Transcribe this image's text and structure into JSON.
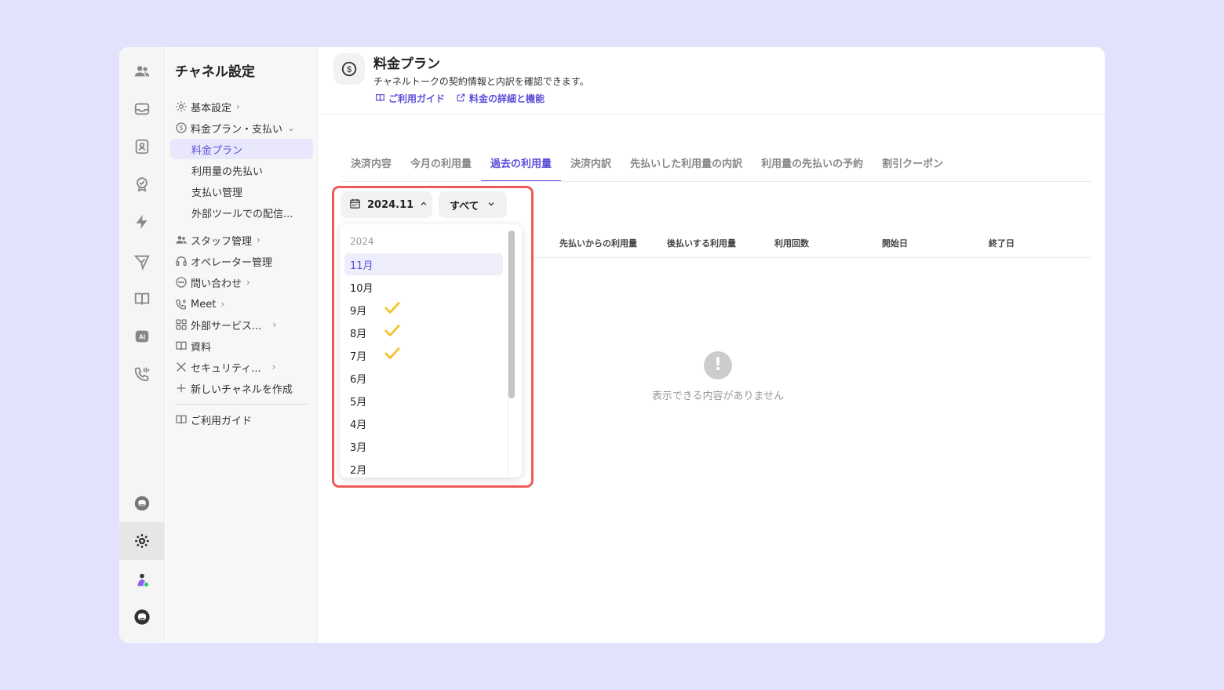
{
  "sidebar": {
    "title": "チャネル設定",
    "items": [
      {
        "label": "基本設定",
        "chev": "›"
      },
      {
        "label": "料金プラン・支払い",
        "chev": "⌄"
      },
      {
        "label": "料金プラン"
      },
      {
        "label": "利用量の先払い"
      },
      {
        "label": "支払い管理"
      },
      {
        "label": "外部ツールでの配信..."
      },
      {
        "label": "スタッフ管理",
        "chev": "›"
      },
      {
        "label": "オペレーター管理"
      },
      {
        "label": "問い合わせ",
        "chev": "›"
      },
      {
        "label": "Meet",
        "chev": "›"
      },
      {
        "label": "外部サービス...",
        "chev": "›"
      },
      {
        "label": "資料"
      },
      {
        "label": "セキュリティ...",
        "chev": "›"
      },
      {
        "label": "新しいチャネルを作成"
      },
      {
        "label": "ご利用ガイド"
      }
    ]
  },
  "header": {
    "title": "料金プラン",
    "description": "チャネルトークの契約情報と内訳を確認できます。",
    "link_guide": "ご利用ガイド",
    "link_details": "料金の詳細と機能"
  },
  "tabs": [
    "決済内容",
    "今月の利用量",
    "過去の利用量",
    "決済内訳",
    "先払いした利用量の内訳",
    "利用量の先払いの予約",
    "割引クーポン"
  ],
  "active_tab": "過去の利用量",
  "filters": {
    "date_value": "2024.11",
    "status_value": "すべて"
  },
  "table": {
    "columns": [
      "先払いからの利用量",
      "後払いする利用量",
      "利用回数",
      "開始日",
      "終了日"
    ]
  },
  "empty_state": {
    "message": "表示できる内容がありません"
  },
  "dropdown": {
    "year": "2024",
    "months": [
      {
        "label": "11月",
        "selected": true,
        "checked": false
      },
      {
        "label": "10月",
        "selected": false,
        "checked": false
      },
      {
        "label": "9月",
        "selected": false,
        "checked": true
      },
      {
        "label": "8月",
        "selected": false,
        "checked": true
      },
      {
        "label": "7月",
        "selected": false,
        "checked": true
      },
      {
        "label": "6月",
        "selected": false,
        "checked": false
      },
      {
        "label": "5月",
        "selected": false,
        "checked": false
      },
      {
        "label": "4月",
        "selected": false,
        "checked": false
      },
      {
        "label": "3月",
        "selected": false,
        "checked": false
      },
      {
        "label": "2月",
        "selected": false,
        "checked": false
      }
    ]
  },
  "colors": {
    "accent": "#5b4fd9",
    "highlight": "#ee5a5a",
    "check": "#f5c430",
    "background": "#e3e2fd"
  }
}
